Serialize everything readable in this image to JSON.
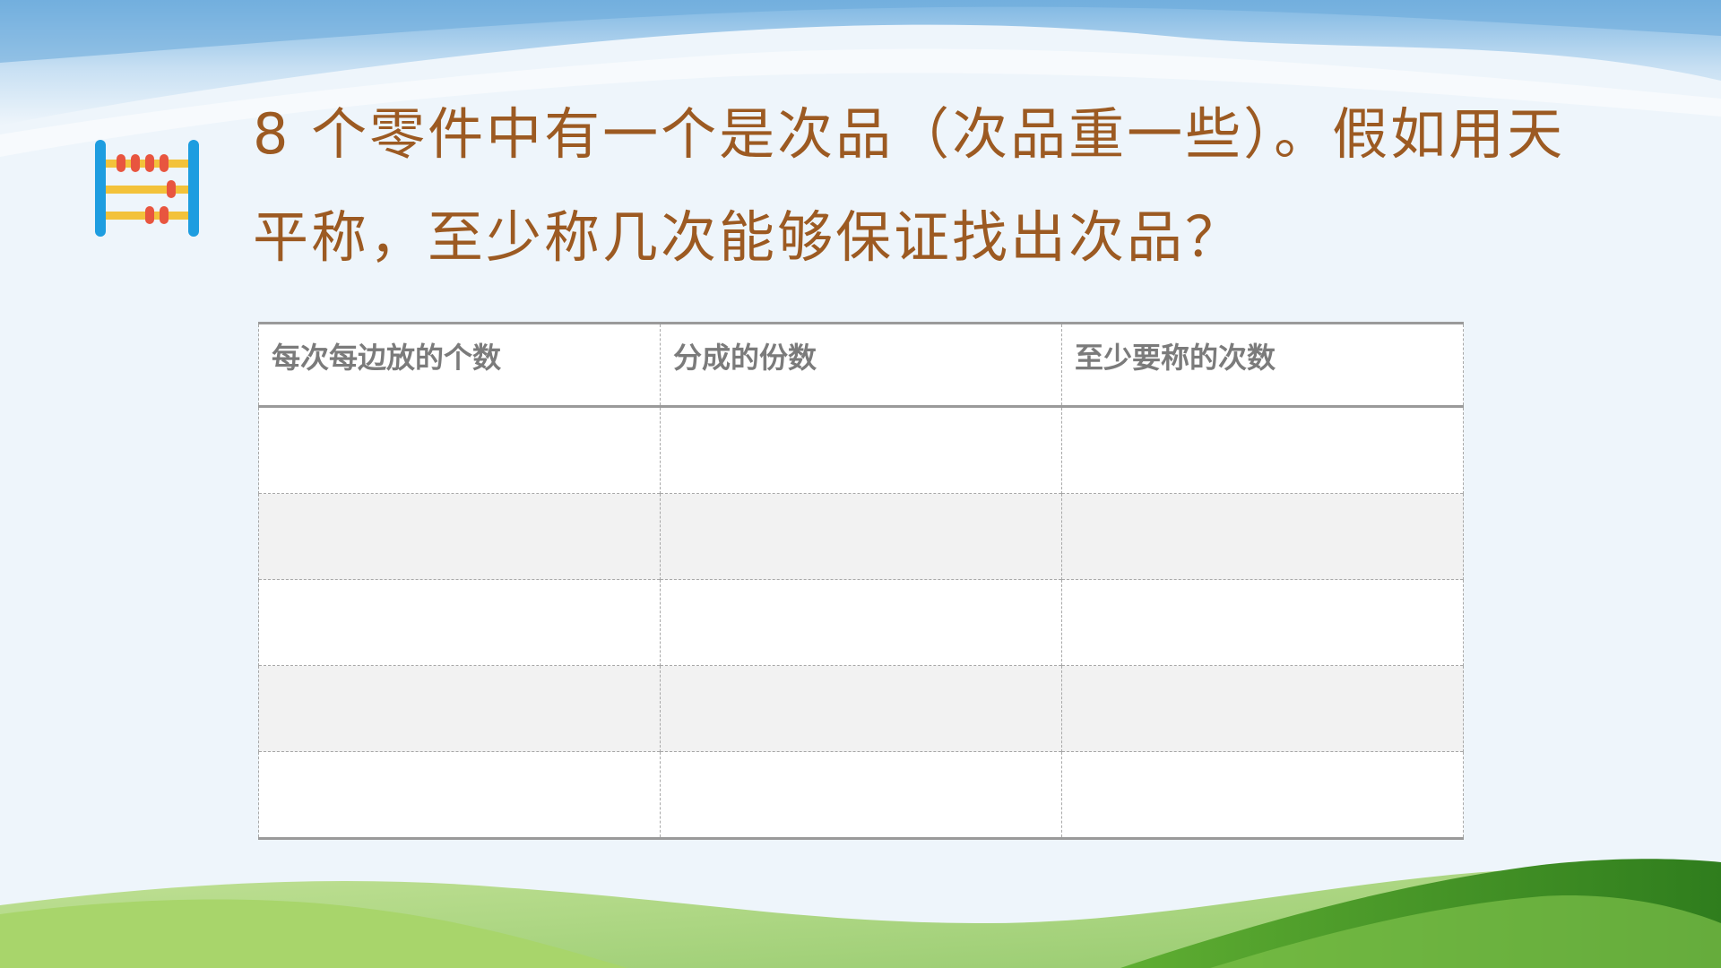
{
  "question": {
    "number": "8",
    "line1_rest": " 个零件中有一个是次品（次品重一些）。假如用天",
    "line2": "平称，至少称几次能够保证找出次品？"
  },
  "table": {
    "headers": [
      "每次每边放的个数",
      "分成的份数",
      "至少要称的次数"
    ],
    "rows": [
      [
        "",
        "",
        ""
      ],
      [
        "",
        "",
        ""
      ],
      [
        "",
        "",
        ""
      ],
      [
        "",
        "",
        ""
      ],
      [
        "",
        "",
        ""
      ]
    ]
  },
  "icons": {
    "abacus": "abacus-icon"
  },
  "colors": {
    "question_text": "#9c5a22",
    "header_text": "#7b7b7b",
    "sky": "#8fc3e8",
    "grass_dark": "#4a9a2a",
    "grass_light": "#9bd06a"
  }
}
